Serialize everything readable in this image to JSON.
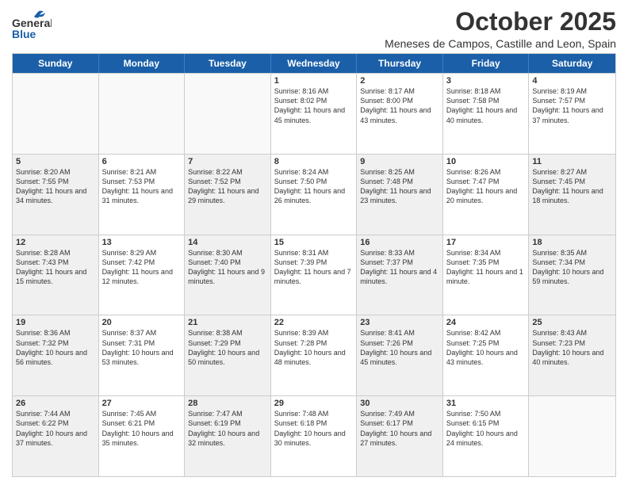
{
  "header": {
    "logo": {
      "general": "General",
      "blue": "Blue"
    },
    "month": "October 2025",
    "location": "Meneses de Campos, Castille and Leon, Spain"
  },
  "weekdays": [
    "Sunday",
    "Monday",
    "Tuesday",
    "Wednesday",
    "Thursday",
    "Friday",
    "Saturday"
  ],
  "rows": [
    [
      {
        "day": "",
        "text": "",
        "empty": true
      },
      {
        "day": "",
        "text": "",
        "empty": true
      },
      {
        "day": "",
        "text": "",
        "empty": true
      },
      {
        "day": "1",
        "text": "Sunrise: 8:16 AM\nSunset: 8:02 PM\nDaylight: 11 hours and 45 minutes."
      },
      {
        "day": "2",
        "text": "Sunrise: 8:17 AM\nSunset: 8:00 PM\nDaylight: 11 hours and 43 minutes."
      },
      {
        "day": "3",
        "text": "Sunrise: 8:18 AM\nSunset: 7:58 PM\nDaylight: 11 hours and 40 minutes."
      },
      {
        "day": "4",
        "text": "Sunrise: 8:19 AM\nSunset: 7:57 PM\nDaylight: 11 hours and 37 minutes."
      }
    ],
    [
      {
        "day": "5",
        "text": "Sunrise: 8:20 AM\nSunset: 7:55 PM\nDaylight: 11 hours and 34 minutes.",
        "shaded": true
      },
      {
        "day": "6",
        "text": "Sunrise: 8:21 AM\nSunset: 7:53 PM\nDaylight: 11 hours and 31 minutes."
      },
      {
        "day": "7",
        "text": "Sunrise: 8:22 AM\nSunset: 7:52 PM\nDaylight: 11 hours and 29 minutes.",
        "shaded": true
      },
      {
        "day": "8",
        "text": "Sunrise: 8:24 AM\nSunset: 7:50 PM\nDaylight: 11 hours and 26 minutes."
      },
      {
        "day": "9",
        "text": "Sunrise: 8:25 AM\nSunset: 7:48 PM\nDaylight: 11 hours and 23 minutes.",
        "shaded": true
      },
      {
        "day": "10",
        "text": "Sunrise: 8:26 AM\nSunset: 7:47 PM\nDaylight: 11 hours and 20 minutes."
      },
      {
        "day": "11",
        "text": "Sunrise: 8:27 AM\nSunset: 7:45 PM\nDaylight: 11 hours and 18 minutes.",
        "shaded": true
      }
    ],
    [
      {
        "day": "12",
        "text": "Sunrise: 8:28 AM\nSunset: 7:43 PM\nDaylight: 11 hours and 15 minutes.",
        "shaded": true
      },
      {
        "day": "13",
        "text": "Sunrise: 8:29 AM\nSunset: 7:42 PM\nDaylight: 11 hours and 12 minutes."
      },
      {
        "day": "14",
        "text": "Sunrise: 8:30 AM\nSunset: 7:40 PM\nDaylight: 11 hours and 9 minutes.",
        "shaded": true
      },
      {
        "day": "15",
        "text": "Sunrise: 8:31 AM\nSunset: 7:39 PM\nDaylight: 11 hours and 7 minutes."
      },
      {
        "day": "16",
        "text": "Sunrise: 8:33 AM\nSunset: 7:37 PM\nDaylight: 11 hours and 4 minutes.",
        "shaded": true
      },
      {
        "day": "17",
        "text": "Sunrise: 8:34 AM\nSunset: 7:35 PM\nDaylight: 11 hours and 1 minute."
      },
      {
        "day": "18",
        "text": "Sunrise: 8:35 AM\nSunset: 7:34 PM\nDaylight: 10 hours and 59 minutes.",
        "shaded": true
      }
    ],
    [
      {
        "day": "19",
        "text": "Sunrise: 8:36 AM\nSunset: 7:32 PM\nDaylight: 10 hours and 56 minutes.",
        "shaded": true
      },
      {
        "day": "20",
        "text": "Sunrise: 8:37 AM\nSunset: 7:31 PM\nDaylight: 10 hours and 53 minutes."
      },
      {
        "day": "21",
        "text": "Sunrise: 8:38 AM\nSunset: 7:29 PM\nDaylight: 10 hours and 50 minutes.",
        "shaded": true
      },
      {
        "day": "22",
        "text": "Sunrise: 8:39 AM\nSunset: 7:28 PM\nDaylight: 10 hours and 48 minutes."
      },
      {
        "day": "23",
        "text": "Sunrise: 8:41 AM\nSunset: 7:26 PM\nDaylight: 10 hours and 45 minutes.",
        "shaded": true
      },
      {
        "day": "24",
        "text": "Sunrise: 8:42 AM\nSunset: 7:25 PM\nDaylight: 10 hours and 43 minutes."
      },
      {
        "day": "25",
        "text": "Sunrise: 8:43 AM\nSunset: 7:23 PM\nDaylight: 10 hours and 40 minutes.",
        "shaded": true
      }
    ],
    [
      {
        "day": "26",
        "text": "Sunrise: 7:44 AM\nSunset: 6:22 PM\nDaylight: 10 hours and 37 minutes.",
        "shaded": true
      },
      {
        "day": "27",
        "text": "Sunrise: 7:45 AM\nSunset: 6:21 PM\nDaylight: 10 hours and 35 minutes."
      },
      {
        "day": "28",
        "text": "Sunrise: 7:47 AM\nSunset: 6:19 PM\nDaylight: 10 hours and 32 minutes.",
        "shaded": true
      },
      {
        "day": "29",
        "text": "Sunrise: 7:48 AM\nSunset: 6:18 PM\nDaylight: 10 hours and 30 minutes."
      },
      {
        "day": "30",
        "text": "Sunrise: 7:49 AM\nSunset: 6:17 PM\nDaylight: 10 hours and 27 minutes.",
        "shaded": true
      },
      {
        "day": "31",
        "text": "Sunrise: 7:50 AM\nSunset: 6:15 PM\nDaylight: 10 hours and 24 minutes."
      },
      {
        "day": "",
        "text": "",
        "empty": true
      }
    ]
  ]
}
